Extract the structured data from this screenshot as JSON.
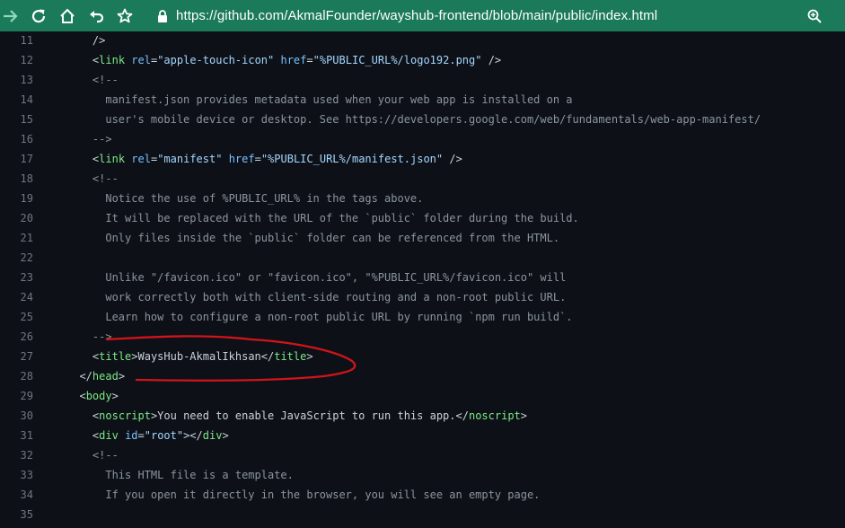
{
  "browser": {
    "url": "https://github.com/AkmalFounder/wayshub-frontend/blob/main/public/index.html",
    "icons": [
      "forward-icon",
      "reload-icon",
      "home-icon",
      "undo-icon",
      "bookmark-star-icon",
      "lock-icon",
      "zoom-icon"
    ],
    "toolbar_color": "#1b7a59"
  },
  "code": {
    "lines": [
      {
        "n": "11",
        "indent": "    ",
        "tokens": [
          [
            "punct",
            "/>"
          ]
        ]
      },
      {
        "n": "12",
        "indent": "    ",
        "tokens": [
          [
            "punct",
            "<"
          ],
          [
            "tag",
            "link"
          ],
          [
            "punct",
            " "
          ],
          [
            "attr",
            "rel"
          ],
          [
            "punct",
            "="
          ],
          [
            "str",
            "\"apple-touch-icon\""
          ],
          [
            "punct",
            " "
          ],
          [
            "attr",
            "href"
          ],
          [
            "punct",
            "="
          ],
          [
            "str",
            "\"%PUBLIC_URL%/logo192.png\""
          ],
          [
            "punct",
            " />"
          ]
        ]
      },
      {
        "n": "13",
        "indent": "    ",
        "tokens": [
          [
            "cmt",
            "<!--"
          ]
        ]
      },
      {
        "n": "14",
        "indent": "      ",
        "tokens": [
          [
            "cmt",
            "manifest.json provides metadata used when your web app is installed on a"
          ]
        ]
      },
      {
        "n": "15",
        "indent": "      ",
        "tokens": [
          [
            "cmt",
            "user's mobile device or desktop. See https://developers.google.com/web/fundamentals/web-app-manifest/"
          ]
        ]
      },
      {
        "n": "16",
        "indent": "    ",
        "tokens": [
          [
            "cmt",
            "-->"
          ]
        ]
      },
      {
        "n": "17",
        "indent": "    ",
        "tokens": [
          [
            "punct",
            "<"
          ],
          [
            "tag",
            "link"
          ],
          [
            "punct",
            " "
          ],
          [
            "attr",
            "rel"
          ],
          [
            "punct",
            "="
          ],
          [
            "str",
            "\"manifest\""
          ],
          [
            "punct",
            " "
          ],
          [
            "attr",
            "href"
          ],
          [
            "punct",
            "="
          ],
          [
            "str",
            "\"%PUBLIC_URL%/manifest.json\""
          ],
          [
            "punct",
            " />"
          ]
        ]
      },
      {
        "n": "18",
        "indent": "    ",
        "tokens": [
          [
            "cmt",
            "<!--"
          ]
        ]
      },
      {
        "n": "19",
        "indent": "      ",
        "tokens": [
          [
            "cmt",
            "Notice the use of %PUBLIC_URL% in the tags above."
          ]
        ]
      },
      {
        "n": "20",
        "indent": "      ",
        "tokens": [
          [
            "cmt",
            "It will be replaced with the URL of the `public` folder during the build."
          ]
        ]
      },
      {
        "n": "21",
        "indent": "      ",
        "tokens": [
          [
            "cmt",
            "Only files inside the `public` folder can be referenced from the HTML."
          ]
        ]
      },
      {
        "n": "22",
        "indent": "",
        "tokens": []
      },
      {
        "n": "23",
        "indent": "      ",
        "tokens": [
          [
            "cmt",
            "Unlike \"/favicon.ico\" or \"favicon.ico\", \"%PUBLIC_URL%/favicon.ico\" will"
          ]
        ]
      },
      {
        "n": "24",
        "indent": "      ",
        "tokens": [
          [
            "cmt",
            "work correctly both with client-side routing and a non-root public URL."
          ]
        ]
      },
      {
        "n": "25",
        "indent": "      ",
        "tokens": [
          [
            "cmt",
            "Learn how to configure a non-root public URL by running `npm run build`."
          ]
        ]
      },
      {
        "n": "26",
        "indent": "    ",
        "tokens": [
          [
            "cmt",
            "-->"
          ]
        ]
      },
      {
        "n": "27",
        "indent": "    ",
        "tokens": [
          [
            "punct",
            "<"
          ],
          [
            "tag",
            "title"
          ],
          [
            "punct",
            ">"
          ],
          [
            "txt",
            "WaysHub-AkmalIkhsan"
          ],
          [
            "punct",
            "</"
          ],
          [
            "tag",
            "title"
          ],
          [
            "punct",
            ">"
          ]
        ]
      },
      {
        "n": "28",
        "indent": "  ",
        "tokens": [
          [
            "punct",
            "</"
          ],
          [
            "tag",
            "head"
          ],
          [
            "punct",
            ">"
          ]
        ]
      },
      {
        "n": "29",
        "indent": "  ",
        "tokens": [
          [
            "punct",
            "<"
          ],
          [
            "tag",
            "body"
          ],
          [
            "punct",
            ">"
          ]
        ]
      },
      {
        "n": "30",
        "indent": "    ",
        "tokens": [
          [
            "punct",
            "<"
          ],
          [
            "tag",
            "noscript"
          ],
          [
            "punct",
            ">"
          ],
          [
            "txt",
            "You need to enable JavaScript to run this app."
          ],
          [
            "punct",
            "</"
          ],
          [
            "tag",
            "noscript"
          ],
          [
            "punct",
            ">"
          ]
        ]
      },
      {
        "n": "31",
        "indent": "    ",
        "tokens": [
          [
            "punct",
            "<"
          ],
          [
            "tag",
            "div"
          ],
          [
            "punct",
            " "
          ],
          [
            "attr",
            "id"
          ],
          [
            "punct",
            "="
          ],
          [
            "str",
            "\"root\""
          ],
          [
            "punct",
            "></"
          ],
          [
            "tag",
            "div"
          ],
          [
            "punct",
            ">"
          ]
        ]
      },
      {
        "n": "32",
        "indent": "    ",
        "tokens": [
          [
            "cmt",
            "<!--"
          ]
        ]
      },
      {
        "n": "33",
        "indent": "      ",
        "tokens": [
          [
            "cmt",
            "This HTML file is a template."
          ]
        ]
      },
      {
        "n": "34",
        "indent": "      ",
        "tokens": [
          [
            "cmt",
            "If you open it directly in the browser, you will see an empty page."
          ]
        ]
      },
      {
        "n": "35",
        "indent": "",
        "tokens": []
      }
    ]
  },
  "colors": {
    "tag": "#7ee787",
    "attr": "#79c0ff",
    "string": "#a5d6ff",
    "comment": "#8b949e",
    "text": "#c9d1d9",
    "line_number": "#6e7681",
    "background": "#0d1117",
    "annotation": "#d0141a"
  }
}
